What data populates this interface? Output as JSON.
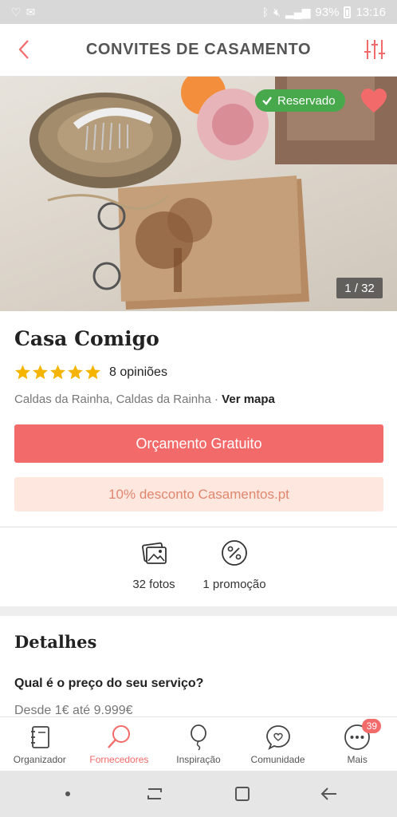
{
  "status_bar": {
    "battery": "93%",
    "time": "13:16"
  },
  "header": {
    "title": "CONVITES DE CASAMENTO"
  },
  "hero": {
    "reserved_label": "Reservado",
    "photo_counter": "1 / 32"
  },
  "vendor": {
    "name": "Casa Comigo",
    "rating_stars": 5,
    "reviews": "8 opiniões",
    "location": "Caldas da Rainha, Caldas da Rainha",
    "separator": " · ",
    "map_link": "Ver mapa"
  },
  "actions": {
    "quote_button": "Orçamento Gratuito",
    "discount_banner": "10% desconto Casamentos.pt"
  },
  "stats": {
    "photos": "32 fotos",
    "promotions": "1 promoção"
  },
  "details": {
    "title": "Detalhes",
    "question": "Qual é o preço do seu serviço?",
    "price": "Desde 1€ até 9.999€"
  },
  "tabs": [
    {
      "label": "Organizador"
    },
    {
      "label": "Fornecedores"
    },
    {
      "label": "Inspiração"
    },
    {
      "label": "Comunidade"
    },
    {
      "label": "Mais",
      "badge": "39"
    }
  ],
  "colors": {
    "accent": "#f36a6a",
    "reserved": "#47a94b",
    "star": "#f5b400",
    "discount_bg": "#fde7df"
  }
}
